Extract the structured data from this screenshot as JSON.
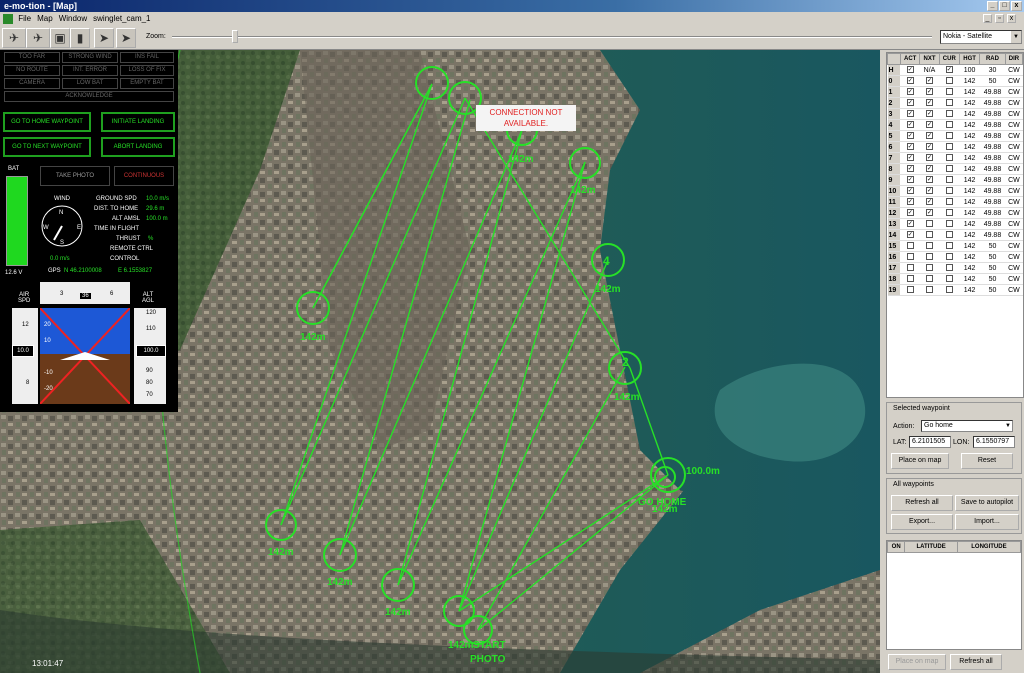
{
  "window": {
    "title": "e-mo-tion - [Map]"
  },
  "menu": [
    "File",
    "Map",
    "Window",
    "swinglet_cam_1"
  ],
  "toolbar": {
    "zoom_label": "Zoom:",
    "map_source": "Nokia - Satellite"
  },
  "status_banner": "CONNECTION NOT AVAILABLE.",
  "clock": "13:01:47",
  "warnings": [
    "TOO FAR",
    "STRONG WIND",
    "INS FAIL",
    "NO ROUTE",
    "INT. ERROR",
    "LOSS OF FIX",
    "CAMERA",
    "LOW BAT",
    "EMPTY BAT",
    "ACKNOWLEDGE"
  ],
  "cmd": {
    "go_home": "GO TO HOME WAYPOINT",
    "initiate_landing": "INITIATE LANDING",
    "go_next": "GO TO NEXT WAYPOINT",
    "abort_landing": "ABORT LANDING",
    "take_photo": "TAKE PHOTO",
    "continuous": "CONTINUOUS"
  },
  "telemetry": {
    "bat_label": "BAT",
    "voltage": "12.6 V",
    "wind_label": "WIND",
    "wind_speed": "0.0 m/s",
    "ground_spd_label": "GROUND SPD",
    "ground_spd": "10.0 m/s",
    "dist_home_label": "DIST. TO HOME",
    "dist_home": "29.6 m",
    "alt_amsl_label": "ALT AMSL",
    "alt_amsl": "100.0 m",
    "time_flight_label": "TIME IN FLIGHT",
    "thrust_label": "THRUST",
    "thrust": "%",
    "remote_ctrl_label": "REMOTE CTRL",
    "control_label": "CONTROL",
    "gps_label": "GPS",
    "lat": "N 46.2100008",
    "lon": "E 6.1553827"
  },
  "pfd": {
    "air_spd": "AIR\nSPD",
    "heading": "36",
    "hdg_left": "3",
    "hdg_right": "6",
    "spd_value": "10.0",
    "alt_label": "ALT\nAGL",
    "alt_value": "100.0",
    "pitch_up": "20",
    "pitch_up2": "10",
    "pitch_down": "-10",
    "pitch_down2": "-20",
    "spd_12": "12",
    "spd_8": "8",
    "alt_120": "120",
    "alt_110": "110",
    "alt_90": "90",
    "alt_80": "80",
    "alt_70": "70"
  },
  "waypoint_table": {
    "headers": [
      "",
      "ACT",
      "NXT",
      "CUR",
      "HGT",
      "RAD",
      "DIR"
    ],
    "rows": [
      [
        "H",
        "x",
        "N/A",
        "x",
        "100",
        "30",
        "CW"
      ],
      [
        "0",
        "x",
        "x",
        "",
        "142",
        "50",
        "CW"
      ],
      [
        "1",
        "x",
        "x",
        "",
        "142",
        "49.88",
        "CW"
      ],
      [
        "2",
        "x",
        "x",
        "",
        "142",
        "49.88",
        "CW"
      ],
      [
        "3",
        "x",
        "x",
        "",
        "142",
        "49.88",
        "CW"
      ],
      [
        "4",
        "x",
        "x",
        "",
        "142",
        "49.88",
        "CW"
      ],
      [
        "5",
        "x",
        "x",
        "",
        "142",
        "49.88",
        "CW"
      ],
      [
        "6",
        "x",
        "x",
        "",
        "142",
        "49.88",
        "CW"
      ],
      [
        "7",
        "x",
        "x",
        "",
        "142",
        "49.88",
        "CW"
      ],
      [
        "8",
        "x",
        "x",
        "",
        "142",
        "49.88",
        "CW"
      ],
      [
        "9",
        "x",
        "x",
        "",
        "142",
        "49.88",
        "CW"
      ],
      [
        "10",
        "x",
        "x",
        "",
        "142",
        "49.88",
        "CW"
      ],
      [
        "11",
        "x",
        "x",
        "",
        "142",
        "49.88",
        "CW"
      ],
      [
        "12",
        "x",
        "x",
        "",
        "142",
        "49.88",
        "CW"
      ],
      [
        "13",
        "x",
        "",
        "",
        "142",
        "49.88",
        "CW"
      ],
      [
        "14",
        "x",
        "",
        "",
        "142",
        "49.88",
        "CW"
      ],
      [
        "15",
        "",
        "",
        "",
        "142",
        "50",
        "CW"
      ],
      [
        "16",
        "",
        "",
        "",
        "142",
        "50",
        "CW"
      ],
      [
        "17",
        "",
        "",
        "",
        "142",
        "50",
        "CW"
      ],
      [
        "18",
        "",
        "",
        "",
        "142",
        "50",
        "CW"
      ],
      [
        "19",
        "",
        "",
        "",
        "142",
        "50",
        "CW"
      ]
    ]
  },
  "selected_wp": {
    "title": "Selected waypoint",
    "action_label": "Action:",
    "action": "Go home",
    "lat_label": "LAT:",
    "lat": "6.2101505",
    "lon_label": "LON:",
    "lon": "6.1550797",
    "place_btn": "Place on map",
    "reset_btn": "Reset"
  },
  "all_wp": {
    "title": "All waypoints",
    "refresh": "Refresh all",
    "save": "Save to autopilot",
    "export": "Export...",
    "import": "Import..."
  },
  "latlon_table": {
    "headers": [
      "ON",
      "LATITUDE",
      "LONGITUDE"
    ]
  },
  "bottom": {
    "place": "Place on map",
    "refresh": "Refresh all"
  },
  "map_labels": {
    "wp_alt": "142m",
    "home_alt": "100.0m",
    "start": "START",
    "photo": "PHOTO",
    "gohome": "GO HOME",
    "wp4": "4",
    "wp2": "2"
  }
}
